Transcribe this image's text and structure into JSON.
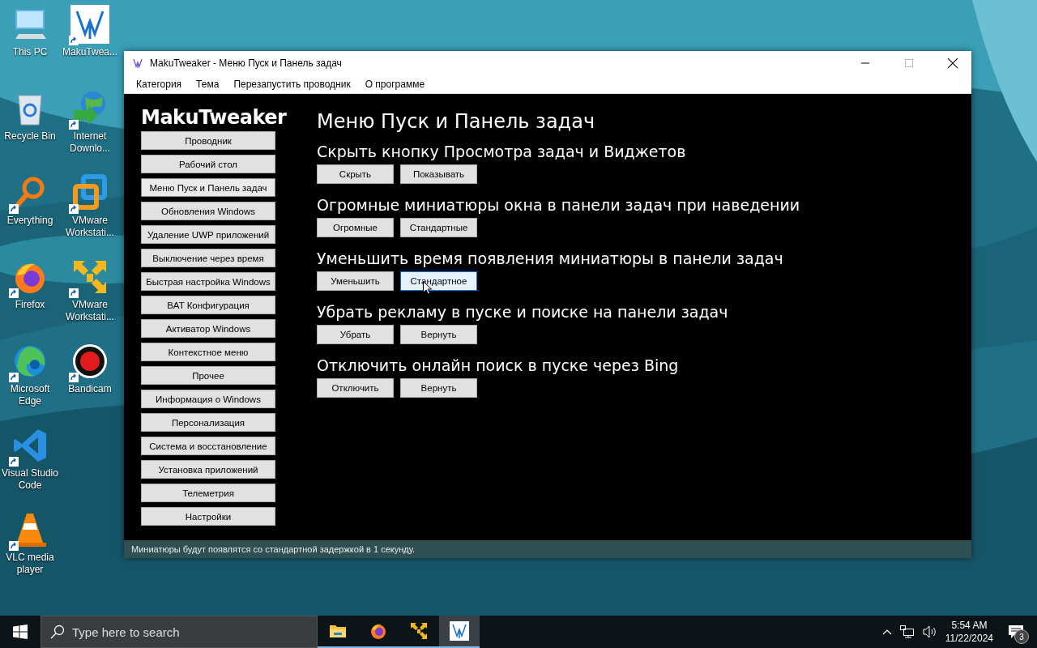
{
  "desktop_icons": [
    {
      "label": "This PC",
      "kind": "pc"
    },
    {
      "label": "Recycle Bin",
      "kind": "bin"
    },
    {
      "label": "Everything",
      "kind": "search"
    },
    {
      "label": "Firefox",
      "kind": "firefox"
    },
    {
      "label": "Microsoft Edge",
      "kind": "edge"
    },
    {
      "label": "Visual Studio Code",
      "kind": "vscode"
    },
    {
      "label": "VLC media player",
      "kind": "vlc"
    },
    {
      "label": "MakuTwea...",
      "kind": "maku"
    },
    {
      "label": "Internet Downlo...",
      "kind": "globe"
    },
    {
      "label": "VMware Workstati...",
      "kind": "vmware"
    },
    {
      "label": "VMware Workstati...",
      "kind": "vmarrows"
    },
    {
      "label": "Bandicam",
      "kind": "record"
    }
  ],
  "window": {
    "title": "MakuTweaker - Меню Пуск и Панель задач",
    "menu": [
      "Категория",
      "Тема",
      "Перезапустить проводник",
      "О программе"
    ],
    "sidebar": {
      "title": "MakuTweaker",
      "items": [
        {
          "label": "Проводник",
          "selected": false
        },
        {
          "label": "Рабочий стол",
          "selected": false
        },
        {
          "label": "Меню Пуск и Панель задач",
          "selected": true
        },
        {
          "label": "Обновления Windows",
          "selected": false
        },
        {
          "label": "Удаление UWP приложений",
          "selected": false
        },
        {
          "label": "Выключение через время",
          "selected": false
        },
        {
          "label": "Быстрая настройка Windows",
          "selected": false
        },
        {
          "label": "BAT Конфигурация",
          "selected": false
        },
        {
          "label": "Активатор Windows",
          "selected": false
        },
        {
          "label": "Контекстное меню",
          "selected": false
        },
        {
          "label": "Прочее",
          "selected": false
        },
        {
          "label": "Информация о Windows",
          "selected": false
        },
        {
          "label": "Персонализация",
          "selected": false
        },
        {
          "label": "Система и восстановление",
          "selected": false
        },
        {
          "label": "Установка приложений",
          "selected": false
        },
        {
          "label": "Телеметрия",
          "selected": false
        },
        {
          "label": "Настройки",
          "selected": false
        }
      ]
    },
    "heading": "Меню Пуск и Панель задач",
    "sections": [
      {
        "title": "Скрыть кнопку Просмотра задач и Виджетов",
        "buttons": [
          {
            "label": "Скрыть",
            "hovered": false
          },
          {
            "label": "Показывать",
            "hovered": false
          }
        ]
      },
      {
        "title": "Огромные миниатюры окна в панели задач при наведении",
        "buttons": [
          {
            "label": "Огромные",
            "hovered": false
          },
          {
            "label": "Стандартные",
            "hovered": false
          }
        ]
      },
      {
        "title": "Уменьшить время появления миниатюры в панели задач",
        "buttons": [
          {
            "label": "Уменьшить",
            "hovered": false
          },
          {
            "label": "Стандартное",
            "hovered": true
          }
        ]
      },
      {
        "title": "Убрать рекламу в пуске и поиске на панели задач",
        "buttons": [
          {
            "label": "Убрать",
            "hovered": false
          },
          {
            "label": "Вернуть",
            "hovered": false
          }
        ]
      },
      {
        "title": "Отключить онлайн поиск в пуске через Bing",
        "buttons": [
          {
            "label": "Отключить",
            "hovered": false
          },
          {
            "label": "Вернуть",
            "hovered": false
          }
        ]
      }
    ],
    "status_bar": "Миниатюры будут появлятся со стандартной задержкой в 1 секунду."
  },
  "taskbar": {
    "search_placeholder": "Type here to search",
    "apps": [
      {
        "kind": "folder",
        "selected": false
      },
      {
        "kind": "firefox",
        "selected": false
      },
      {
        "kind": "vmarrows",
        "selected": false
      },
      {
        "kind": "maku",
        "selected": true
      }
    ],
    "time": "5:54 AM",
    "date": "11/22/2024",
    "notifications": "3"
  }
}
